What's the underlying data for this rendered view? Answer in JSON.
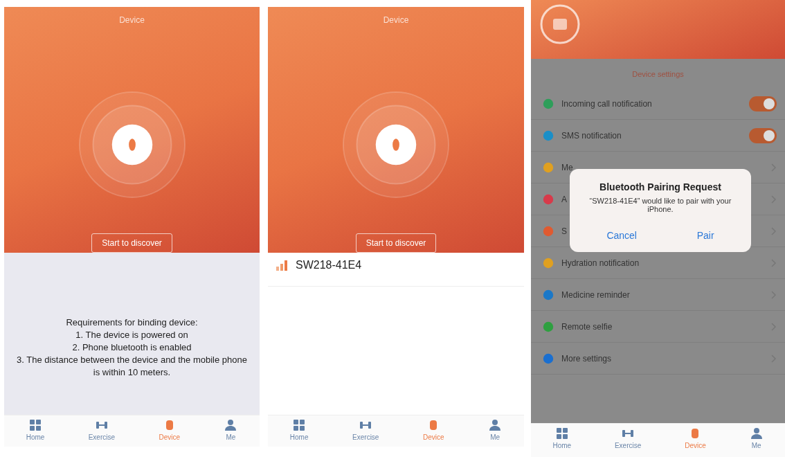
{
  "screens": [
    {
      "kind": "discover",
      "title": "Device",
      "button": "Start to discover",
      "requirements": [
        "Requirements for binding device:",
        "1. The device is powered on",
        "2. Phone bluetooth is enabled",
        "3. The distance between the device and the mobile phone is within 10 meters."
      ],
      "tabs": [
        {
          "label": "Home",
          "selected": false
        },
        {
          "label": "Exercise",
          "selected": false
        },
        {
          "label": "Device",
          "selected": true
        },
        {
          "label": "Me",
          "selected": false
        }
      ]
    },
    {
      "kind": "found",
      "title": "Device",
      "button": "Start to discover",
      "devices": [
        {
          "name": "SW218-41E4"
        }
      ],
      "tabs": [
        {
          "label": "Home",
          "selected": false
        },
        {
          "label": "Exercise",
          "selected": false
        },
        {
          "label": "Device",
          "selected": true
        },
        {
          "label": "Me",
          "selected": false
        }
      ]
    },
    {
      "kind": "settings",
      "section": "Device settings",
      "rows": [
        {
          "label": "Incoming call notification",
          "kind": "toggle",
          "on": true,
          "color": "#2e9e5a"
        },
        {
          "label": "SMS notification",
          "kind": "toggle",
          "on": true,
          "color": "#1a8fc8"
        },
        {
          "label": "Me",
          "kind": "link",
          "color": "#e0a020"
        },
        {
          "label": "A",
          "kind": "link",
          "color": "#d83a4a"
        },
        {
          "label": "S",
          "kind": "link",
          "color": "#e05a30"
        },
        {
          "label": "Hydration notification",
          "kind": "link",
          "color": "#e0a020"
        },
        {
          "label": "Medicine reminder",
          "kind": "link",
          "color": "#1a78c8"
        },
        {
          "label": "Remote selfie",
          "kind": "link",
          "color": "#2ea040"
        },
        {
          "label": "More settings",
          "kind": "link",
          "color": "#1a6fd0"
        }
      ],
      "dialog": {
        "title": "Bluetooth Pairing Request",
        "message": "“SW218-41E4” would like to pair with your iPhone.",
        "buttons": [
          "Cancel",
          "Pair"
        ]
      },
      "tabs": [
        {
          "label": "Home",
          "selected": false
        },
        {
          "label": "Exercise",
          "selected": false
        },
        {
          "label": "Device",
          "selected": true
        },
        {
          "label": "Me",
          "selected": false
        }
      ]
    }
  ]
}
